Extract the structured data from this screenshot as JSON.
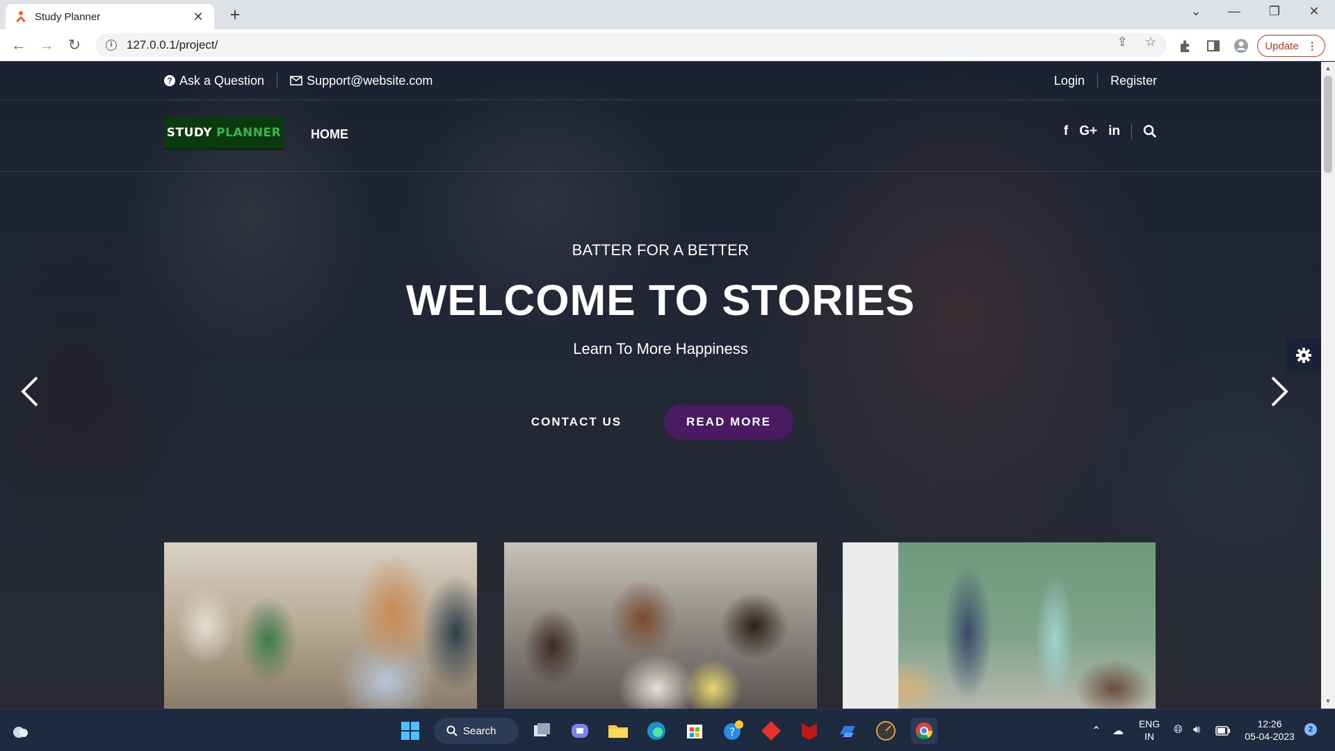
{
  "browser": {
    "tab_title": "Study Planner",
    "url": "127.0.0.1/project/",
    "update_label": "Update"
  },
  "topbar": {
    "ask_question": "Ask a Question",
    "support_email": "Support@website.com",
    "login": "Login",
    "register": "Register"
  },
  "nav": {
    "logo_word1": "STUDY",
    "logo_word2": "PLANNER",
    "home": "HOME"
  },
  "hero": {
    "subtitle": "BATTER FOR A BETTER",
    "title": "WELCOME TO STORIES",
    "tagline": "Learn To More Happiness",
    "contact_button": "CONTACT US",
    "read_more_button": "READ MORE"
  },
  "colors": {
    "read_more_bg": "#4a1a63",
    "logo_bg": "#0c3a0f",
    "logo_accent": "#39b54a",
    "update_red": "#d93025",
    "taskbar_bg": "#1d2a3f"
  },
  "taskbar": {
    "search_label": "Search",
    "lang_line1": "ENG",
    "lang_line2": "IN",
    "time": "12:26",
    "date": "05-04-2023",
    "notification_count": "2"
  }
}
